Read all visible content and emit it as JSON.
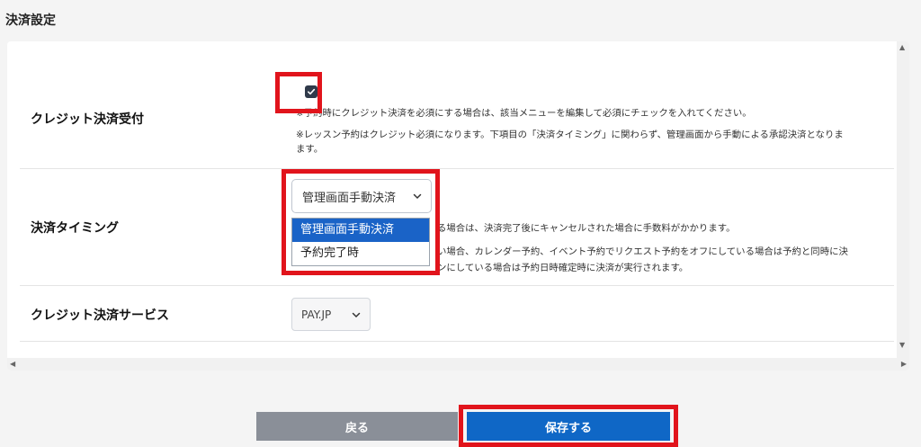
{
  "section": {
    "title": "決済設定"
  },
  "credit_accept": {
    "label": "クレジット決済受付",
    "checked": true,
    "note1": "※予約時にクレジット決済を必須にする場合は、該当メニューを編集して必須にチェックを入れてください。",
    "note2a": "※レッスン予約はクレジット必須になります。下項目の「決済タイミング」に関わらず、管理画面から手動による承認決済となりま",
    "note2b": "ます。"
  },
  "timing": {
    "label": "決済タイミング",
    "selected": "管理画面手動決済",
    "options": [
      "管理画面手動決済",
      "予約完了時"
    ],
    "note1": "る場合は、決済完了後にキャンセルされた場合に手数料がかかります。",
    "note2": "い場合、カレンダー予約、イベント予約でリクエスト予約をオフにしている場合は予約と同時に決",
    "note3": "ンにしている場合は予約日時確定時に決済が実行されます。"
  },
  "service": {
    "label": "クレジット決済サービス",
    "selected": "PAY.JP"
  },
  "buttons": {
    "back": "戻る",
    "save": "保存する"
  },
  "colors": {
    "highlight": "#e1141c",
    "primary": "#0f67c6",
    "secondary": "#8a8f98"
  },
  "icons": {
    "check": "check-icon",
    "chevron": "chevron-down-icon"
  }
}
